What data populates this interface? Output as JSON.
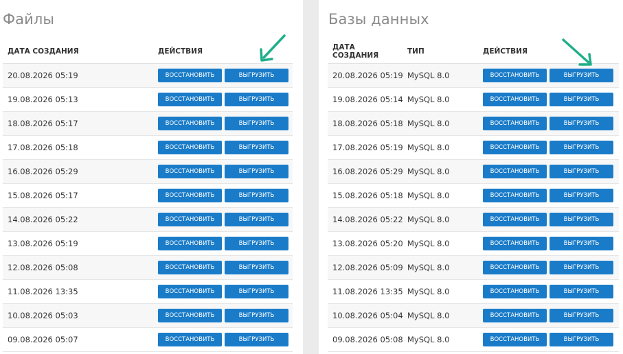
{
  "colors": {
    "accent": "#1a7cc9",
    "arrow": "#1fae8a",
    "title": "#8a8a8a"
  },
  "files": {
    "title": "Файлы",
    "headers": {
      "date": "ДАТА СОЗДАНИЯ",
      "actions": "ДЕЙСТВИЯ"
    },
    "restore_label": "ВОССТАНОВИТЬ",
    "export_label": "ВЫГРУЗИТЬ",
    "rows": [
      {
        "date": "20.08.2026 05:19"
      },
      {
        "date": "19.08.2026 05:13"
      },
      {
        "date": "18.08.2026 05:17"
      },
      {
        "date": "17.08.2026 05:18"
      },
      {
        "date": "16.08.2026 05:29"
      },
      {
        "date": "15.08.2026 05:17"
      },
      {
        "date": "14.08.2026 05:22"
      },
      {
        "date": "13.08.2026 05:19"
      },
      {
        "date": "12.08.2026 05:08"
      },
      {
        "date": "11.08.2026 13:35"
      },
      {
        "date": "10.08.2026 05:03"
      },
      {
        "date": "09.08.2026 05:07"
      }
    ]
  },
  "databases": {
    "title": "Базы данных",
    "headers": {
      "date": "ДАТА СОЗДАНИЯ",
      "type": "ТИП",
      "actions": "ДЕЙСТВИЯ"
    },
    "restore_label": "ВОССТАНОВИТЬ",
    "export_label": "ВЫГРУЗИТЬ",
    "rows": [
      {
        "date": "20.08.2026 05:19",
        "type": "MySQL 8.0"
      },
      {
        "date": "19.08.2026 05:14",
        "type": "MySQL 8.0"
      },
      {
        "date": "18.08.2026 05:18",
        "type": "MySQL 8.0"
      },
      {
        "date": "17.08.2026 05:19",
        "type": "MySQL 8.0"
      },
      {
        "date": "16.08.2026 05:29",
        "type": "MySQL 8.0"
      },
      {
        "date": "15.08.2026 05:18",
        "type": "MySQL 8.0"
      },
      {
        "date": "14.08.2026 05:22",
        "type": "MySQL 8.0"
      },
      {
        "date": "13.08.2026 05:20",
        "type": "MySQL 8.0"
      },
      {
        "date": "12.08.2026 05:09",
        "type": "MySQL 8.0"
      },
      {
        "date": "11.08.2026 13:35",
        "type": "MySQL 8.0"
      },
      {
        "date": "10.08.2026 05:04",
        "type": "MySQL 8.0"
      },
      {
        "date": "09.08.2026 05:08",
        "type": "MySQL 8.0"
      }
    ]
  }
}
